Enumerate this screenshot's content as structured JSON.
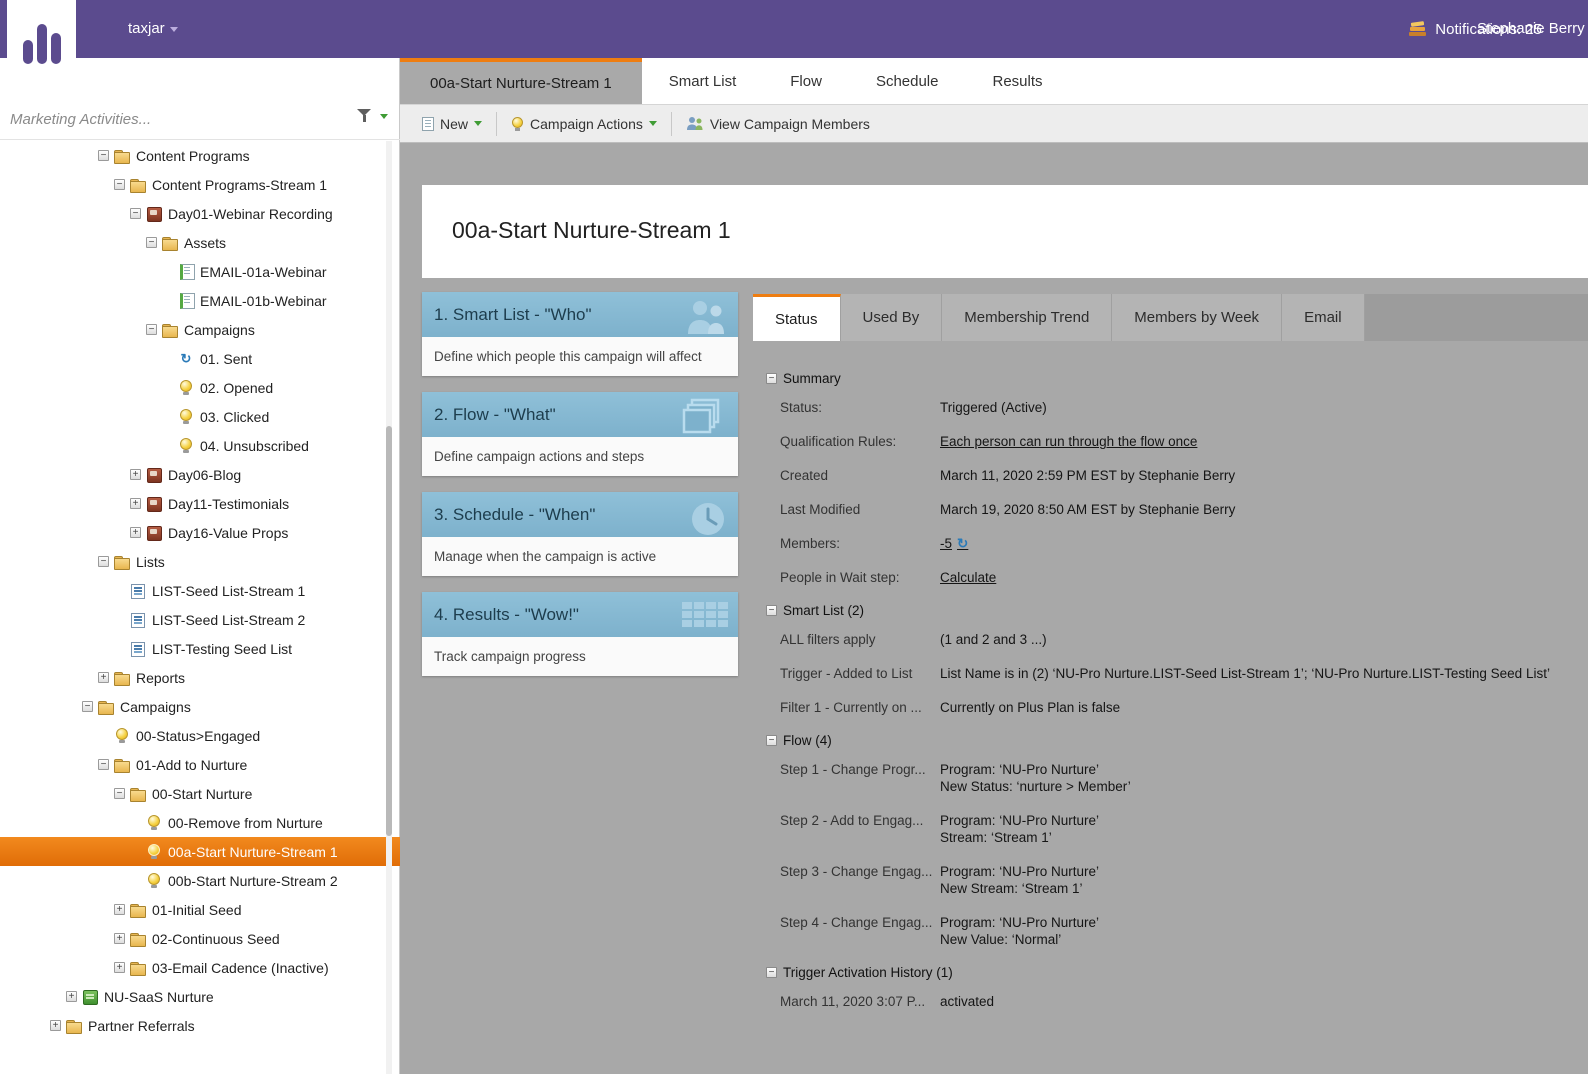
{
  "colors": {
    "brand_purple": "#5b4b8e",
    "accent_orange": "#ee7d11",
    "selected_orange": "#e8740f",
    "card_blue": "#85b8d2",
    "link_blue": "#2a7ab8",
    "caret_green": "#3f9c35",
    "canvas_gray": "#a8a8a8"
  },
  "topbar": {
    "workspace": "taxjar",
    "notifications_label": "Notifications: 25",
    "user_name": "Stephanie Berry"
  },
  "sidebar": {
    "search_placeholder": "Marketing Activities...",
    "tree": [
      {
        "label": "Content Programs",
        "icon": "folder",
        "expand": "minus",
        "level": 3
      },
      {
        "label": "Content Programs-Stream 1",
        "icon": "folder",
        "expand": "minus",
        "level": 4
      },
      {
        "label": "Day01-Webinar Recording",
        "icon": "program",
        "expand": "minus",
        "level": 5
      },
      {
        "label": "Assets",
        "icon": "folder",
        "expand": "minus",
        "level": 6
      },
      {
        "label": "EMAIL-01a-Webinar",
        "icon": "email",
        "level": 7
      },
      {
        "label": "EMAIL-01b-Webinar",
        "icon": "email",
        "level": 7
      },
      {
        "label": "Campaigns",
        "icon": "folder",
        "expand": "minus",
        "level": 6
      },
      {
        "label": "01. Sent",
        "icon": "sent",
        "level": 7
      },
      {
        "label": "02. Opened",
        "icon": "bulb",
        "level": 7
      },
      {
        "label": "03. Clicked",
        "icon": "bulb",
        "level": 7
      },
      {
        "label": "04. Unsubscribed",
        "icon": "bulb",
        "level": 7
      },
      {
        "label": "Day06-Blog",
        "icon": "program",
        "expand": "plus",
        "level": 5
      },
      {
        "label": "Day11-Testimonials",
        "icon": "program",
        "expand": "plus",
        "level": 5
      },
      {
        "label": "Day16-Value Props",
        "icon": "program",
        "expand": "plus",
        "level": 5
      },
      {
        "label": "Lists",
        "icon": "folder",
        "expand": "minus",
        "level": 3
      },
      {
        "label": "LIST-Seed List-Stream 1",
        "icon": "list",
        "level": 4
      },
      {
        "label": "LIST-Seed List-Stream 2",
        "icon": "list",
        "level": 4
      },
      {
        "label": "LIST-Testing Seed List",
        "icon": "list",
        "level": 4
      },
      {
        "label": "Reports",
        "icon": "folder",
        "expand": "plus",
        "level": 3
      },
      {
        "label": "Campaigns",
        "icon": "folder",
        "expand": "minus",
        "level": 2
      },
      {
        "label": "00-Status>Engaged",
        "icon": "bulb",
        "level": 3
      },
      {
        "label": "01-Add to Nurture",
        "icon": "folder",
        "expand": "minus",
        "level": 3
      },
      {
        "label": "00-Start Nurture",
        "icon": "folder",
        "expand": "minus",
        "level": 4
      },
      {
        "label": "00-Remove from Nurture",
        "icon": "bulb",
        "level": 5
      },
      {
        "label": "00a-Start Nurture-Stream 1",
        "icon": "bulb",
        "level": 5,
        "selected": true
      },
      {
        "label": "00b-Start Nurture-Stream 2",
        "icon": "bulb",
        "level": 5
      },
      {
        "label": "01-Initial Seed",
        "icon": "folder",
        "expand": "plus",
        "level": 4
      },
      {
        "label": "02-Continuous Seed",
        "icon": "folder",
        "expand": "plus",
        "level": 4
      },
      {
        "label": "03-Email Cadence (Inactive)",
        "icon": "folder",
        "expand": "plus",
        "level": 4
      },
      {
        "label": "NU-SaaS Nurture",
        "icon": "engagement",
        "expand": "plus",
        "level": 1
      },
      {
        "label": "Partner Referrals",
        "icon": "folder",
        "expand": "plus",
        "level": 0
      }
    ]
  },
  "main_tabs": [
    {
      "label": "00a-Start Nurture-Stream 1",
      "active": true
    },
    {
      "label": "Smart List"
    },
    {
      "label": "Flow"
    },
    {
      "label": "Schedule"
    },
    {
      "label": "Results"
    }
  ],
  "toolbar": {
    "new_label": "New",
    "campaign_actions_label": "Campaign Actions",
    "view_members_label": "View Campaign Members"
  },
  "page_title": "00a-Start Nurture-Stream 1",
  "cards": [
    {
      "title": "1. Smart List - \"Who\"",
      "desc": "Define which people this campaign will affect",
      "icon": "people"
    },
    {
      "title": "2. Flow - \"What\"",
      "desc": "Define campaign actions and steps",
      "icon": "pages"
    },
    {
      "title": "3. Schedule - \"When\"",
      "desc": "Manage when the campaign is active",
      "icon": "clock"
    },
    {
      "title": "4. Results - \"Wow!\"",
      "desc": "Track campaign progress",
      "icon": "grid"
    }
  ],
  "status": {
    "tabs": [
      {
        "label": "Status",
        "active": true
      },
      {
        "label": "Used By"
      },
      {
        "label": "Membership Trend"
      },
      {
        "label": "Members by Week"
      },
      {
        "label": "Email"
      }
    ],
    "sections": [
      {
        "title": "Summary",
        "rows": [
          {
            "label": "Status:",
            "value": "Triggered (Active)"
          },
          {
            "label": "Qualification Rules:",
            "value": "Each person can run through the flow once",
            "link": true
          },
          {
            "label": "Created",
            "value": "March 11, 2020 2:59 PM EST by Stephanie Berry"
          },
          {
            "label": "Last Modified",
            "value": "March 19, 2020 8:50 AM EST by Stephanie Berry"
          },
          {
            "label": "Members:",
            "value": "-5",
            "link": true,
            "refresh": true
          },
          {
            "label": "People in Wait step:",
            "value": "Calculate",
            "link": true
          }
        ]
      },
      {
        "title": "Smart List (2)",
        "rows": [
          {
            "label": "ALL filters apply",
            "value": "(1 and 2 and 3 ...)"
          },
          {
            "label": "Trigger - Added to List",
            "value": "List Name is in (2) ‘NU-Pro Nurture.LIST-Seed List-Stream 1’; ‘NU-Pro Nurture.LIST-Testing Seed List’"
          },
          {
            "label": "Filter 1 - Currently on ...",
            "value": "Currently on Plus Plan is false"
          }
        ]
      },
      {
        "title": "Flow (4)",
        "rows": [
          {
            "label": "Step 1 - Change Progr...",
            "lines": [
              "Program: ‘NU-Pro Nurture’",
              "New Status: ‘nurture > Member’"
            ]
          },
          {
            "label": "Step 2 - Add to Engag...",
            "lines": [
              "Program: ‘NU-Pro Nurture’",
              "Stream: ‘Stream 1’"
            ]
          },
          {
            "label": "Step 3 - Change Engag...",
            "lines": [
              "Program: ‘NU-Pro Nurture’",
              "New Stream: ‘Stream 1’"
            ]
          },
          {
            "label": "Step 4 - Change Engag...",
            "lines": [
              "Program: ‘NU-Pro Nurture’",
              "New Value: ‘Normal’"
            ]
          }
        ]
      },
      {
        "title": "Trigger Activation History (1)",
        "rows": [
          {
            "label": "March 11, 2020 3:07 P...",
            "value": "activated"
          }
        ]
      }
    ]
  }
}
